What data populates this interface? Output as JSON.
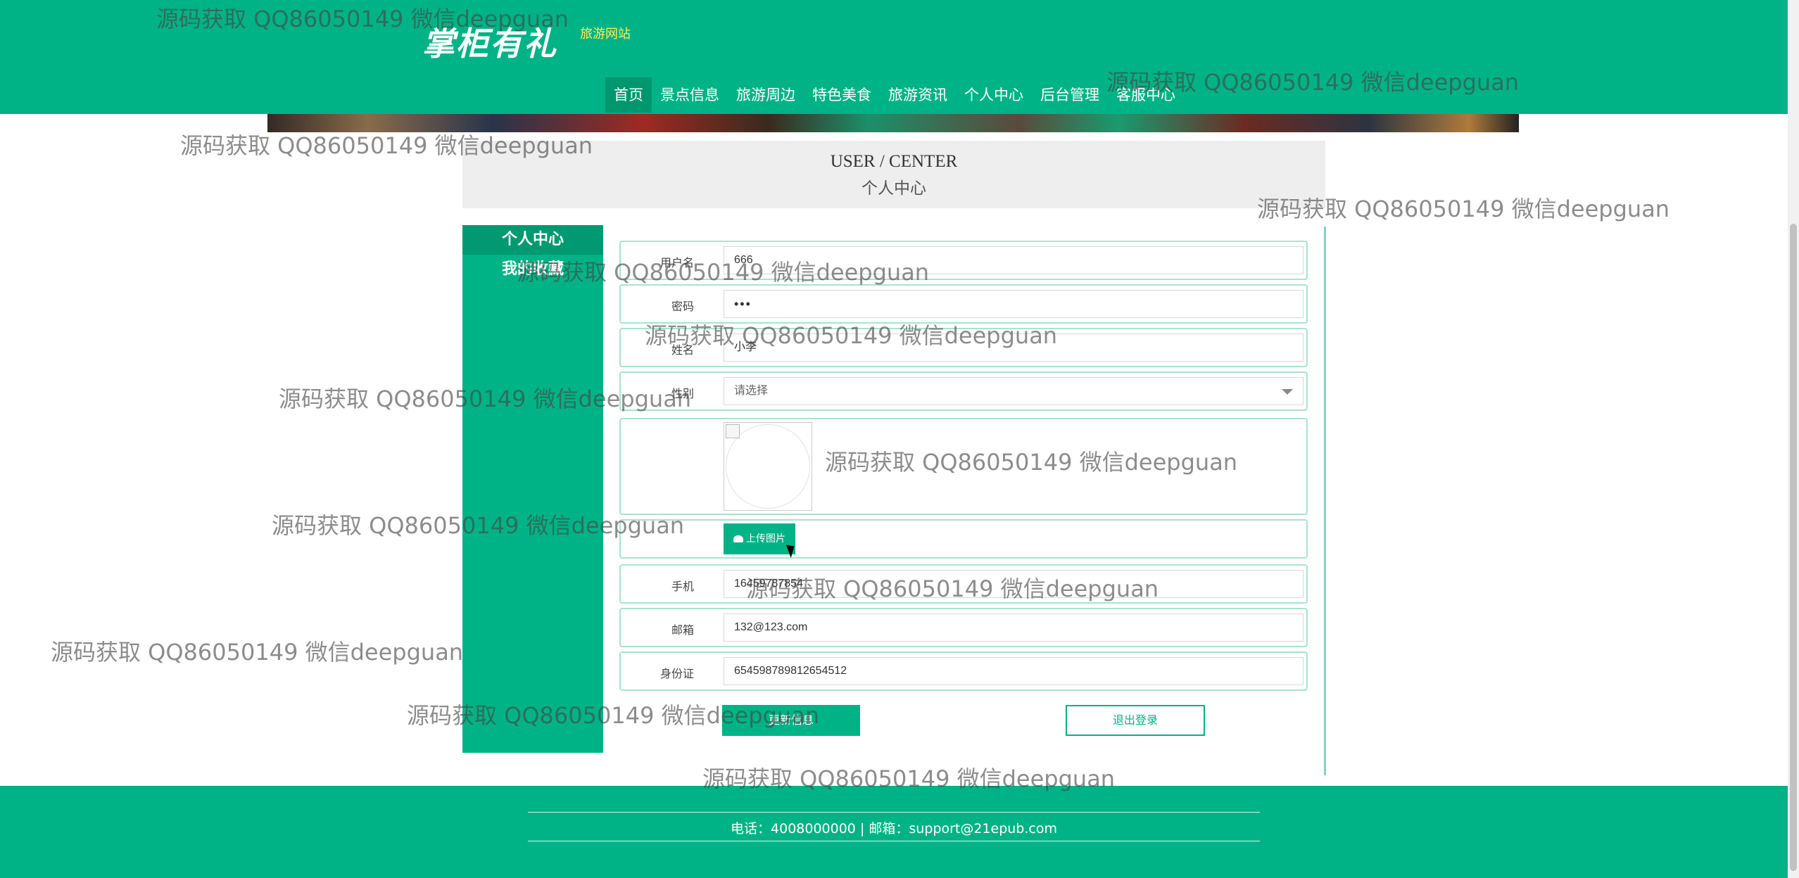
{
  "header": {
    "logo_text": "掌柜有礼",
    "site_tag": "旅游网站",
    "nav": [
      {
        "label": "首页",
        "active": true
      },
      {
        "label": "景点信息",
        "active": false
      },
      {
        "label": "旅游周边",
        "active": false
      },
      {
        "label": "特色美食",
        "active": false
      },
      {
        "label": "旅游资讯",
        "active": false
      },
      {
        "label": "个人中心",
        "active": false
      },
      {
        "label": "后台管理",
        "active": false
      },
      {
        "label": "客服中心",
        "active": false
      }
    ]
  },
  "title": {
    "en": "USER / CENTER",
    "cn": "个人中心"
  },
  "sidebar": {
    "items": [
      {
        "label": "个人中心",
        "active": true
      },
      {
        "label": "我的收藏",
        "active": false
      }
    ]
  },
  "form": {
    "username": {
      "label": "用户名",
      "value": "666"
    },
    "password": {
      "label": "密码",
      "value": "•••"
    },
    "name": {
      "label": "姓名",
      "value": "小李"
    },
    "gender": {
      "label": "性别",
      "placeholder": "请选择"
    },
    "upload_label": "上传图片",
    "phone": {
      "label": "手机",
      "value": "16459787854"
    },
    "email": {
      "label": "邮箱",
      "value": "132@123.com"
    },
    "idcard": {
      "label": "身份证",
      "value": "654598789812654512"
    },
    "update_label": "更新信息",
    "logout_label": "退出登录"
  },
  "footer": {
    "text": "电话：4008000000 | 邮箱：support@21epub.com"
  },
  "watermark": "源码获取 QQ86050149 微信deepguan",
  "colors": {
    "brand": "#00b386",
    "brand_dark": "#009972",
    "accent_yellow": "#ffee55"
  }
}
